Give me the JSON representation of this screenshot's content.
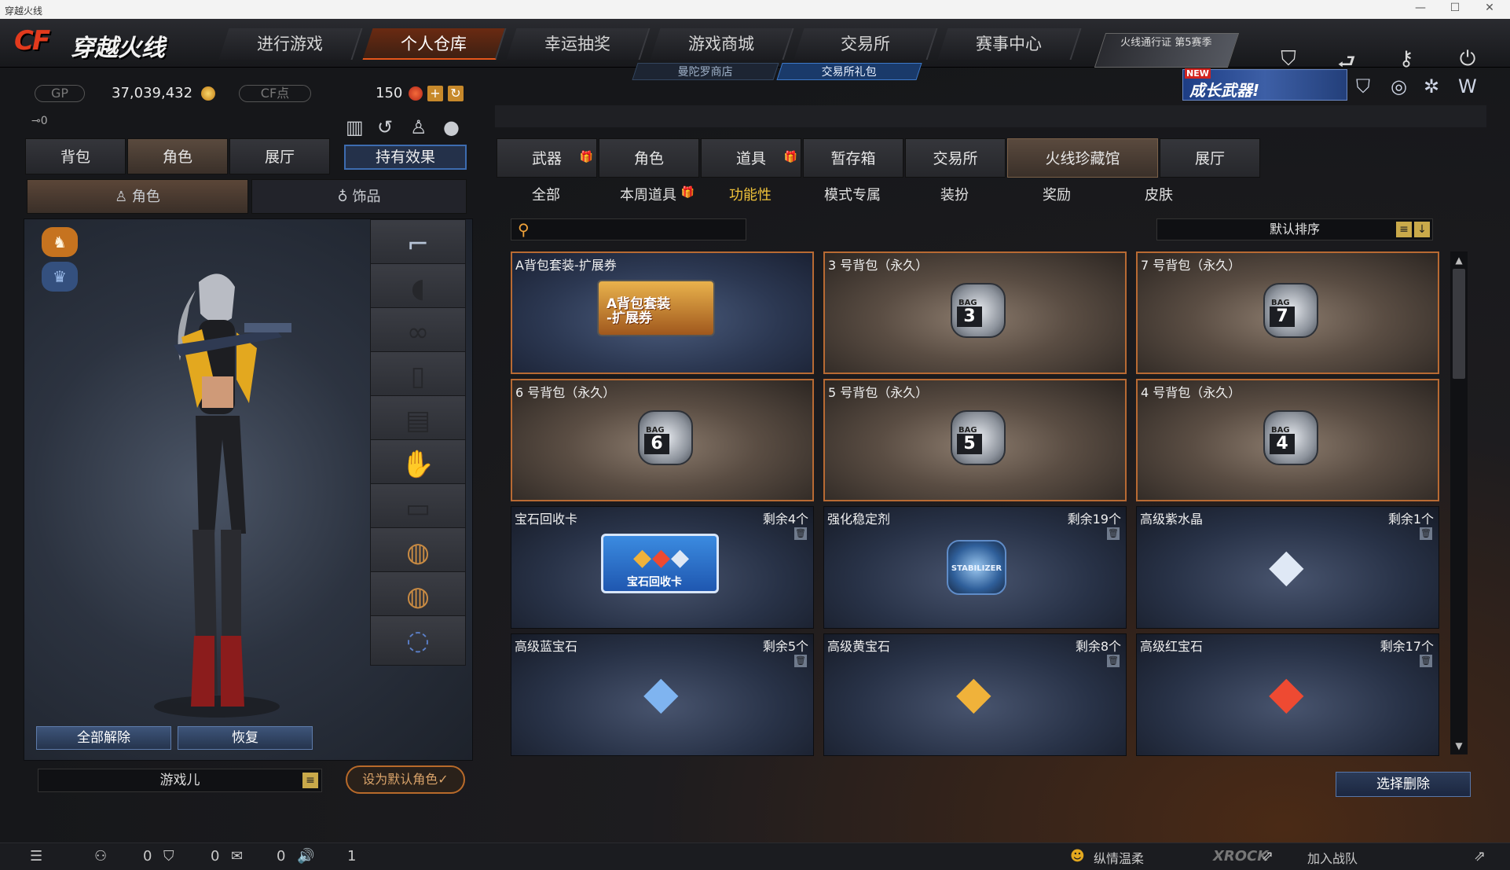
{
  "window": {
    "title": "穿越火线",
    "controls": [
      "—",
      "☐",
      "✕"
    ]
  },
  "logo": {
    "cf": "CF",
    "title": "穿越火线"
  },
  "nav": {
    "tabs": [
      "进行游戏",
      "个人仓库",
      "幸运抽奖",
      "游戏商城",
      "交易所",
      "赛事中心"
    ],
    "active": "个人仓库",
    "subtabs": [
      "曼陀罗商店",
      "交易所礼包"
    ],
    "pass": "火线通行证 第5赛季"
  },
  "currency": {
    "gp_label": "GP",
    "gp_value": "37,039,432",
    "cf_label": "CF点",
    "cf_value": "150"
  },
  "promo": {
    "new": "NEW",
    "text": "成长武器!"
  },
  "left": {
    "key_count": "0",
    "tabs": [
      "背包",
      "角色",
      "展厅"
    ],
    "active_tab": "角色",
    "effect_button": "持有效果",
    "subtabs": [
      "角色",
      "饰品"
    ],
    "buttons": {
      "unequip_all": "全部解除",
      "restore": "恢复"
    },
    "character_name": "游戏儿",
    "set_default": "设为默认角色✓"
  },
  "right": {
    "tabs": [
      "武器",
      "角色",
      "道具",
      "暂存箱",
      "交易所",
      "火线珍藏馆",
      "展厅"
    ],
    "active_tab": "火线珍藏馆",
    "gift_tabs": [
      "武器",
      "道具"
    ],
    "subtabs": [
      "全部",
      "本周道具",
      "功能性",
      "模式专属",
      "装扮",
      "奖励",
      "皮肤"
    ],
    "active_sub": "功能性",
    "search_placeholder": "",
    "sort_label": "默认排序",
    "delete_button": "选择删除",
    "items": [
      {
        "name": "A背包套装-扩展券",
        "qty": "",
        "kind": "voucher",
        "art": "A背包套装\n-扩展券"
      },
      {
        "name": "3 号背包（永久）",
        "qty": "",
        "kind": "bag",
        "num": "3"
      },
      {
        "name": "7 号背包（永久）",
        "qty": "",
        "kind": "bag",
        "num": "7"
      },
      {
        "name": "6 号背包（永久）",
        "qty": "",
        "kind": "bag",
        "num": "6"
      },
      {
        "name": "5 号背包（永久）",
        "qty": "",
        "kind": "bag",
        "num": "5"
      },
      {
        "name": "4 号背包（永久）",
        "qty": "",
        "kind": "bag",
        "num": "4"
      },
      {
        "name": "宝石回收卡",
        "qty": "剩余4个",
        "kind": "gemcard",
        "art": "宝石回收卡"
      },
      {
        "name": "强化稳定剂",
        "qty": "剩余19个",
        "kind": "jar",
        "art": "STABILIZER"
      },
      {
        "name": "高级紫水晶",
        "qty": "剩余1个",
        "kind": "gem",
        "color": "#dfe8f5"
      },
      {
        "name": "高级蓝宝石",
        "qty": "剩余5个",
        "kind": "gem",
        "color": "#7fb4f0"
      },
      {
        "name": "高级黄宝石",
        "qty": "剩余8个",
        "kind": "gem",
        "color": "#f0b23a"
      },
      {
        "name": "高级红宝石",
        "qty": "剩余17个",
        "kind": "gem",
        "color": "#ee4a32"
      }
    ]
  },
  "bottom": {
    "counts": [
      "0",
      "0",
      "0",
      "1"
    ],
    "player": "纵情温柔",
    "brand": "XROCK",
    "join": "加入战队"
  }
}
